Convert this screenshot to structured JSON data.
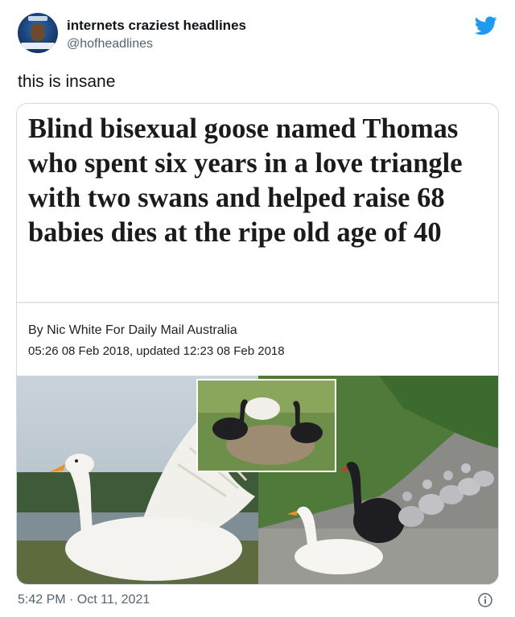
{
  "tweet": {
    "display_name": "internets craziest headlines",
    "handle": "@hofheadlines",
    "text": "this is insane",
    "timestamp": "5:42 PM · Oct 11, 2021"
  },
  "article": {
    "headline": "Blind bisexual goose named Thomas who spent six years in a love triangle with two swans and helped raise 68 babies dies at the ripe old age of 40",
    "byline": "By Nic White For Daily Mail Australia",
    "dateline": "05:26 08 Feb 2018, updated 12:23 08 Feb 2018"
  },
  "icons": {
    "brand": "twitter-bird-icon",
    "info": "info-icon"
  },
  "colors": {
    "twitter_blue": "#1d9bf0",
    "secondary_text": "#536471",
    "border": "#cfd9de"
  }
}
